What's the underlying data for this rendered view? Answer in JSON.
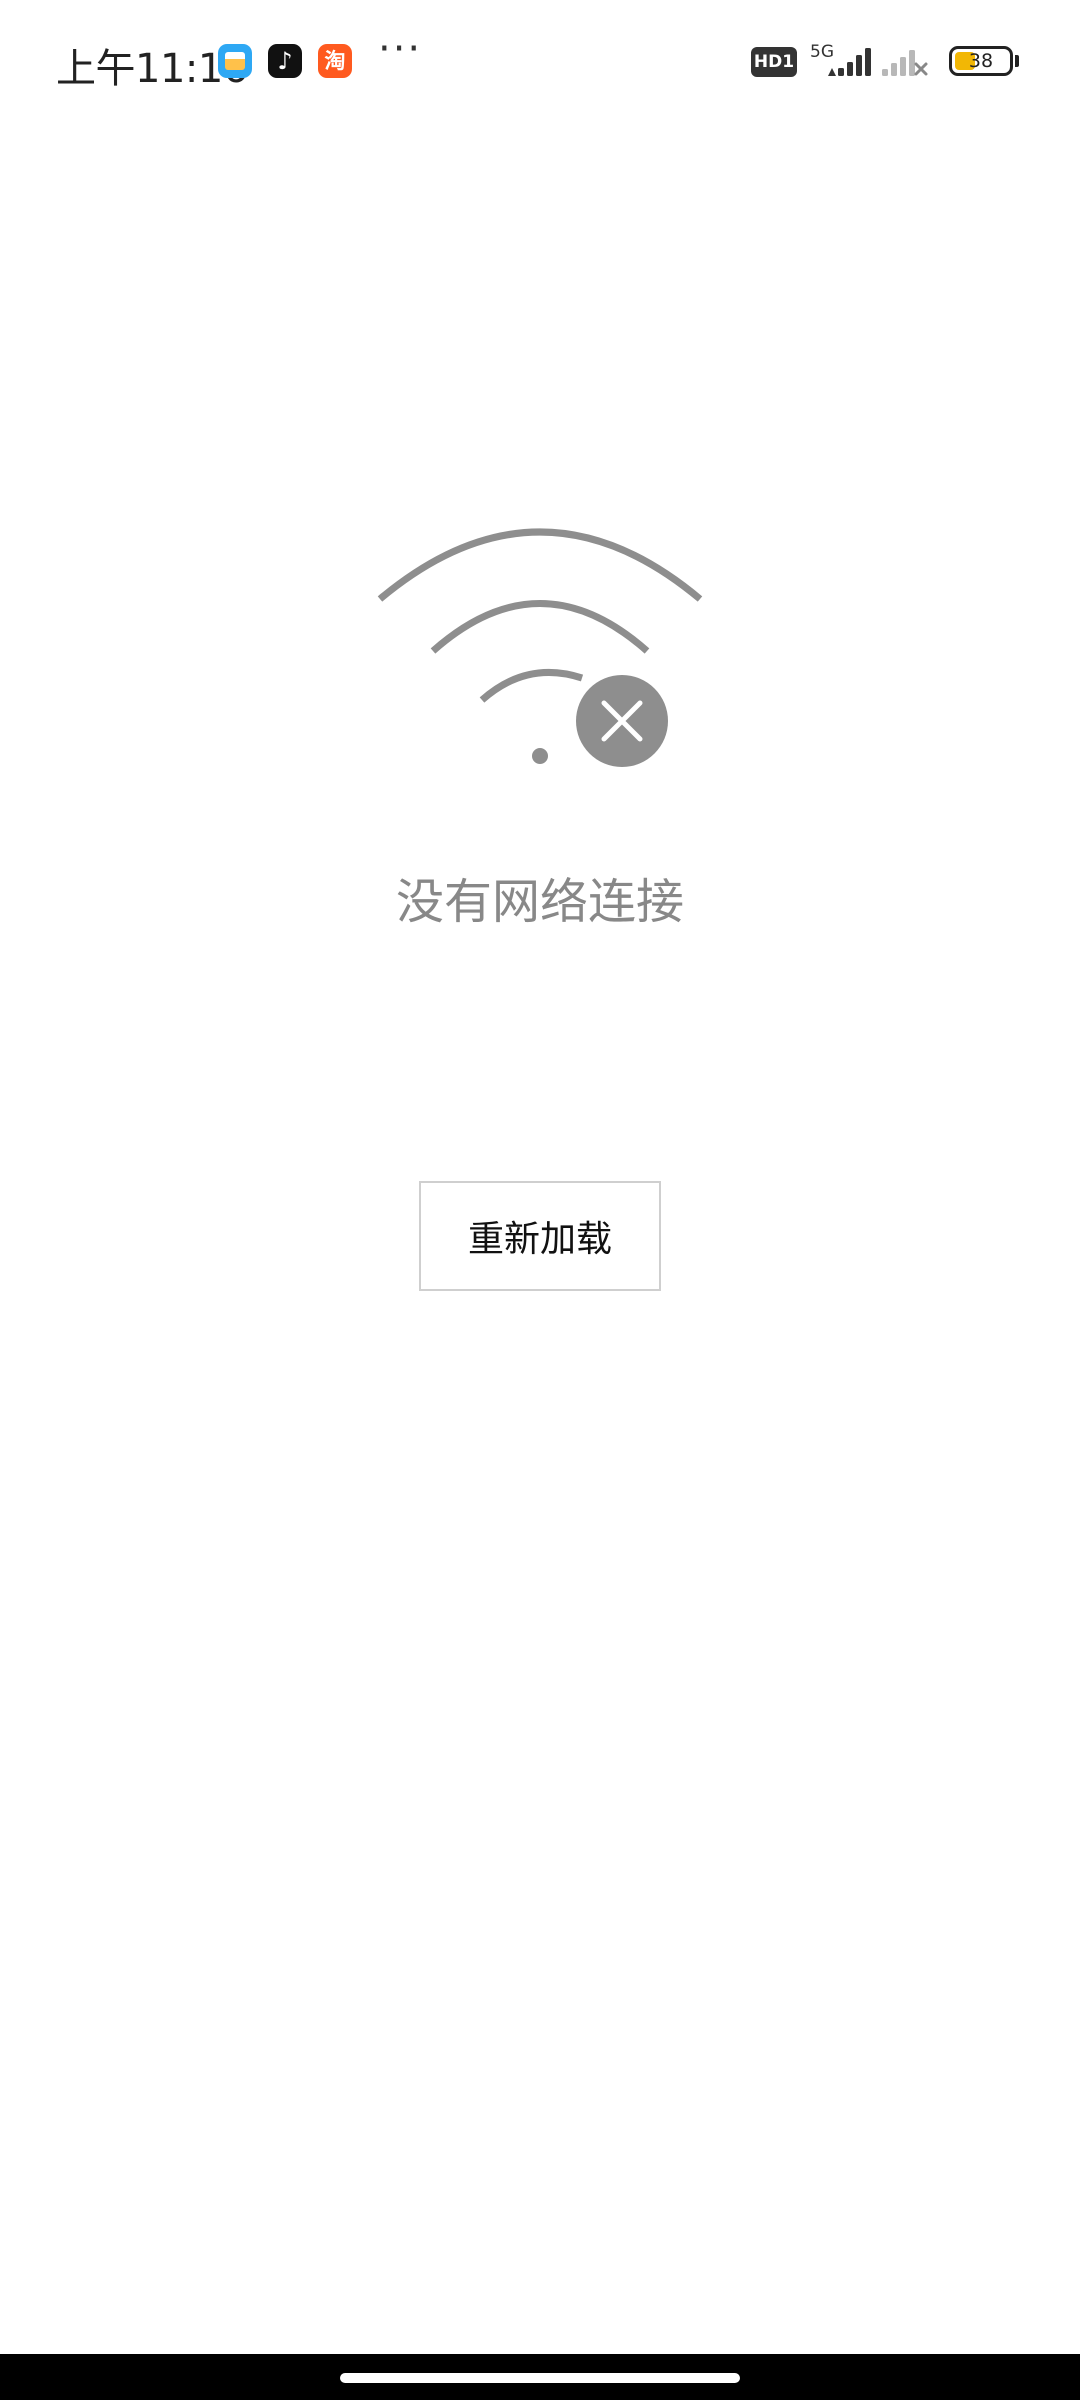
{
  "status_bar": {
    "time": "上午11:16",
    "apps": [
      {
        "icon": "calendar-app-icon",
        "label": ""
      },
      {
        "icon": "tiktok-app-icon",
        "label": "♪"
      },
      {
        "icon": "taobao-app-icon",
        "label": "淘"
      }
    ],
    "more": "···",
    "hd_label": "HD1",
    "network_type": "5G",
    "battery_level": "38",
    "battery_color": "#f2b705"
  },
  "main": {
    "icon": "no-wifi-icon",
    "message": "没有网络连接",
    "reload_label": "重新加载"
  },
  "colors": {
    "icon_gray": "#8e8e8e",
    "message_gray": "#888888",
    "button_border": "#cfcfcf"
  }
}
